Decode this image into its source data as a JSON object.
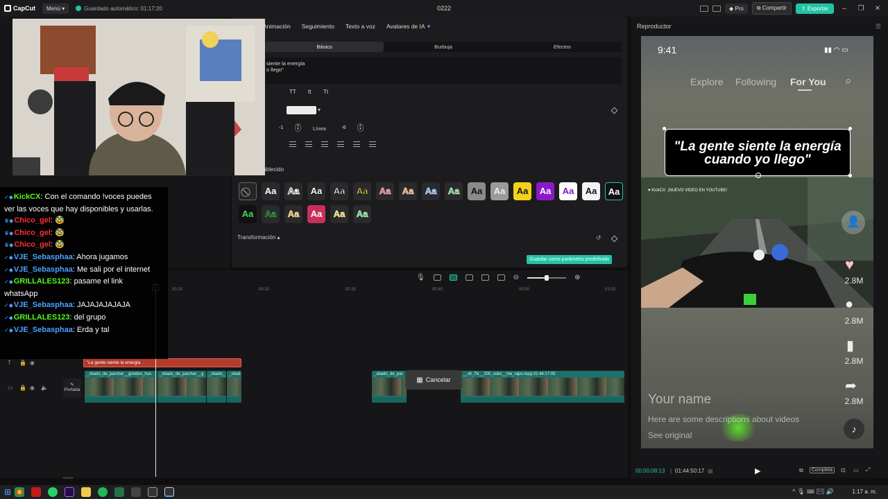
{
  "titlebar": {
    "app_name": "CapCut",
    "menu_label": "Menú",
    "autosave_text": "Guardado automático: 01:17:20",
    "project_title": "0222",
    "pro_label": "Pro",
    "share_label": "Compartir",
    "export_label": "Exportar"
  },
  "inspector": {
    "tabs": [
      "Animación",
      "Seguimiento",
      "Texto a voz",
      "Avatares de IA"
    ],
    "subtabs": [
      "Básico",
      "Burbuja",
      "Efectos"
    ],
    "text_value_line1": "siente la energía",
    "text_value_line2": "o llego\"",
    "case_buttons": [
      "TT",
      "tt",
      "Tt"
    ],
    "spacing_value": "-1",
    "line_label": "Línea",
    "line_value": "-6",
    "preset_label": "tablecido",
    "preset_glyph": "Aa",
    "transform_label": "Transformación",
    "save_default_label": "Guardar como parámetro predefinido"
  },
  "chat": {
    "messages": [
      {
        "user": "KickCX",
        "text": "Con el comando !voces puedes ver las voces que hay disponibles y usarlas.",
        "color": "#53fc18"
      },
      {
        "user": "Chico_gel",
        "text": "🥸",
        "color": "#ff3030"
      },
      {
        "user": "Chico_gel",
        "text": "🥸",
        "color": "#ff3030"
      },
      {
        "user": "Chico_gel",
        "text": "🥸",
        "color": "#ff3030"
      },
      {
        "user": "VJE_Sebasphaa",
        "text": "Ahora jugamos",
        "color": "#4aa3ff"
      },
      {
        "user": "VJE_Sebasphaa",
        "text": "Me sali por el internet",
        "color": "#4aa3ff"
      },
      {
        "user": "GRILLALES123",
        "text": "pasame el link",
        "color": "#53fc18"
      },
      {
        "user": "",
        "text": "whatsApp",
        "color": "#53fc18"
      },
      {
        "user": "VJE_Sebasphaa",
        "text": "JAJAJAJAJAJA",
        "color": "#4aa3ff"
      },
      {
        "user": "GRILLALES123",
        "text": "del grupo",
        "color": "#53fc18"
      },
      {
        "user": "VJE_Sebasphaa",
        "text": "Erda y tal",
        "color": "#4aa3ff"
      }
    ]
  },
  "player": {
    "title": "Reproductor",
    "phone": {
      "time": "9:41",
      "nav": [
        "Explore",
        "Following",
        "For You"
      ],
      "caption_line1": "\"La gente siente la energía",
      "caption_line2": "cuando yo llego\"",
      "counts": [
        "2.8M",
        "2.8M",
        "2.8M",
        "2.8M"
      ],
      "name": "Your name",
      "description": "Here are some descriptions about videos",
      "see_original": "See original"
    },
    "current_time": "00:00:08:13",
    "total_time": "01:44:50:17",
    "fit_label": "Completa"
  },
  "timeline": {
    "ruler": [
      "00:10",
      "00:20",
      "00:30",
      "00:40",
      "00:50",
      "01:00"
    ],
    "text_clip_label": "\"La gente siente la energía",
    "cover_label": "Portada",
    "clip_labels": [
      "_sbado_de_parchar__grindeo_hus",
      "_sbado_de_parchar__g",
      "_sbado_",
      "_sbad",
      "_sbado_de_par",
      "__ull_7lv__200_subs__me_rapo.mpg  01:44:17:05"
    ],
    "cancel_label": "Cancelar"
  },
  "taskbar": {
    "time": "1:17 a. m."
  },
  "colors": {
    "accent": "#22c3a6",
    "text_clip": "#b33b2c",
    "video_clip": "#1f6f6a"
  }
}
